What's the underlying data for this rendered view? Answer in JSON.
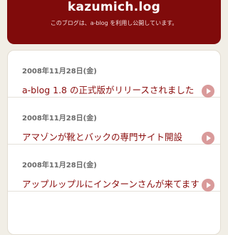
{
  "header": {
    "title": "kazumich.log",
    "tagline": "このブログは、a-blog を利用し公開しています。"
  },
  "entries": [
    {
      "date": "2008年11月28日(金)",
      "title": "a-blog 1.8 の正式版がリリースされました"
    },
    {
      "date": "2008年11月28日(金)",
      "title": "アマゾンが靴とバックの専門サイト開設"
    },
    {
      "date": "2008年11月28日(金)",
      "title": "アップルップルにインターンさんが来てます"
    }
  ],
  "icons": {
    "entry_arrow": "chevron-right-circle-icon"
  },
  "colors": {
    "brand": "#800b0b",
    "link": "#8a0c0c",
    "arrow": "#d99a9a",
    "background": "#f1eee6"
  }
}
